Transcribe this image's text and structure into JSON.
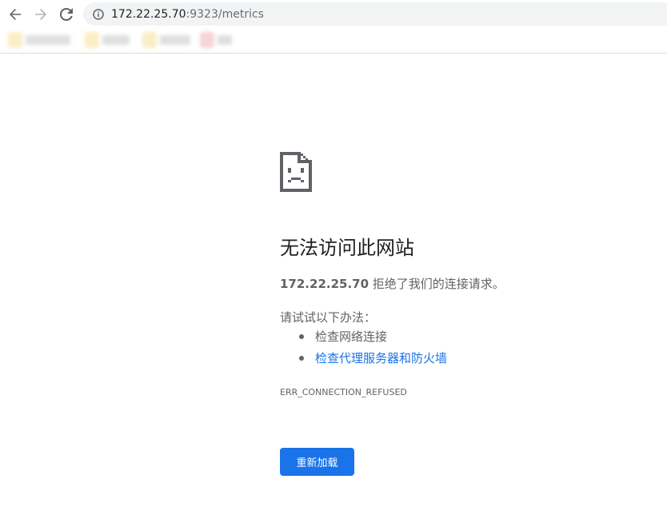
{
  "browser": {
    "url_host": "172.22.25.70",
    "url_path": ":9323/metrics",
    "icons": {
      "back": "arrow-left-icon",
      "forward": "arrow-right-icon",
      "reload": "reload-icon",
      "site_info": "info-icon"
    }
  },
  "error": {
    "icon": "sad-file-icon",
    "title": "无法访问此网站",
    "host": "172.22.25.70",
    "message": " 拒绝了我们的连接请求。",
    "try_label": "请试试以下办法：",
    "suggestions": [
      "检查网络连接",
      "检查代理服务器和防火墙"
    ],
    "code": "ERR_CONNECTION_REFUSED",
    "reload_label": "重新加载"
  },
  "colors": {
    "link": "#1a73e8",
    "button_bg": "#1a73e8",
    "text": "#5f6368",
    "title": "#202124"
  }
}
